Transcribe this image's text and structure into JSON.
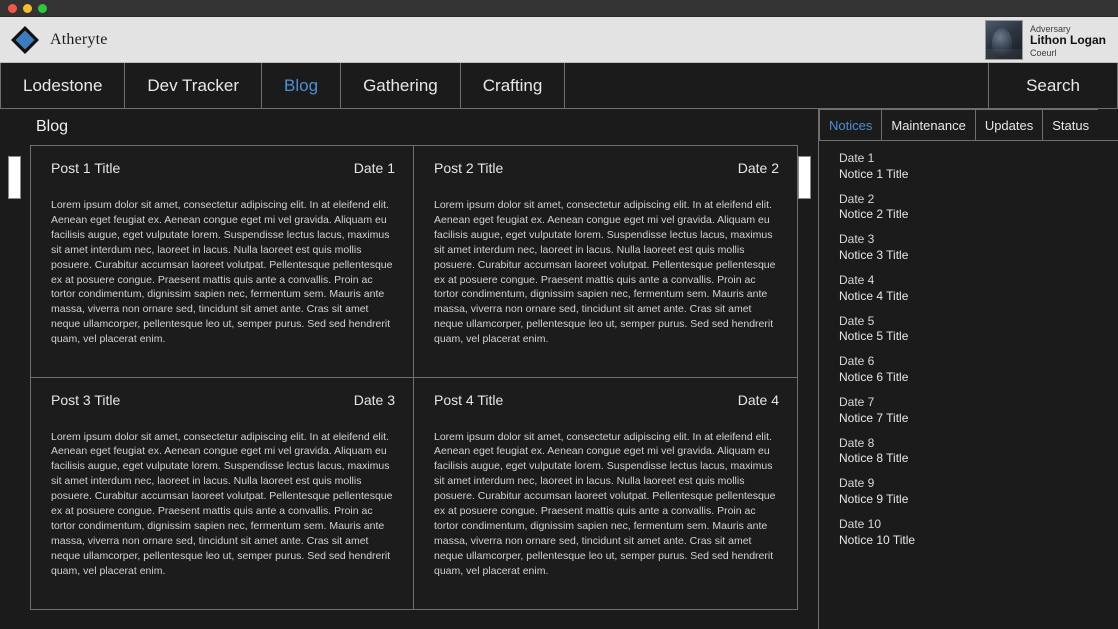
{
  "window": {
    "controls": [
      "close",
      "minimize",
      "maximize"
    ]
  },
  "brand": {
    "name": "Atheryte",
    "logo_icon": "diamond-logo-icon",
    "accent_color": "#4d8fd6"
  },
  "profile": {
    "title": "Adversary",
    "name": "Lithon Logan",
    "world": "Coeurl",
    "avatar_icon": "character-portrait-icon"
  },
  "nav": {
    "items": [
      {
        "label": "Lodestone",
        "active": false
      },
      {
        "label": "Dev Tracker",
        "active": false
      },
      {
        "label": "Blog",
        "active": true
      },
      {
        "label": "Gathering",
        "active": false
      },
      {
        "label": "Crafting",
        "active": false
      }
    ],
    "search_label": "Search"
  },
  "blog": {
    "heading": "Blog",
    "posts": [
      {
        "title": "Post 1 Title",
        "date": "Date 1",
        "body": "Lorem ipsum dolor sit amet, consectetur adipiscing elit. In at eleifend elit. Aenean eget feugiat ex. Aenean congue eget mi vel gravida. Aliquam eu facilisis augue, eget vulputate lorem. Suspendisse lectus lacus, maximus sit amet interdum nec, laoreet in lacus. Nulla laoreet est quis mollis posuere. Curabitur accumsan laoreet volutpat. Pellentesque pellentesque ex at posuere congue. Praesent mattis quis ante a convallis. Proin ac tortor condimentum, dignissim sapien nec, fermentum sem. Mauris ante massa, viverra non ornare sed, tincidunt sit amet ante. Cras sit amet neque ullamcorper, pellentesque leo ut, semper purus. Sed sed hendrerit quam, vel placerat enim."
      },
      {
        "title": "Post 2 Title",
        "date": "Date 2",
        "body": "Lorem ipsum dolor sit amet, consectetur adipiscing elit. In at eleifend elit. Aenean eget feugiat ex. Aenean congue eget mi vel gravida. Aliquam eu facilisis augue, eget vulputate lorem. Suspendisse lectus lacus, maximus sit amet interdum nec, laoreet in lacus. Nulla laoreet est quis mollis posuere. Curabitur accumsan laoreet volutpat. Pellentesque pellentesque ex at posuere congue. Praesent mattis quis ante a convallis. Proin ac tortor condimentum, dignissim sapien nec, fermentum sem. Mauris ante massa, viverra non ornare sed, tincidunt sit amet ante. Cras sit amet neque ullamcorper, pellentesque leo ut, semper purus. Sed sed hendrerit quam, vel placerat enim."
      },
      {
        "title": "Post 3 Title",
        "date": "Date 3",
        "body": "Lorem ipsum dolor sit amet, consectetur adipiscing elit. In at eleifend elit. Aenean eget feugiat ex. Aenean congue eget mi vel gravida. Aliquam eu facilisis augue, eget vulputate lorem. Suspendisse lectus lacus, maximus sit amet interdum nec, laoreet in lacus. Nulla laoreet est quis mollis posuere. Curabitur accumsan laoreet volutpat. Pellentesque pellentesque ex at posuere congue. Praesent mattis quis ante a convallis. Proin ac tortor condimentum, dignissim sapien nec, fermentum sem. Mauris ante massa, viverra non ornare sed, tincidunt sit amet ante. Cras sit amet neque ullamcorper, pellentesque leo ut, semper purus. Sed sed hendrerit quam, vel placerat enim."
      },
      {
        "title": "Post 4 Title",
        "date": "Date 4",
        "body": "Lorem ipsum dolor sit amet, consectetur adipiscing elit. In at eleifend elit. Aenean eget feugiat ex. Aenean congue eget mi vel gravida. Aliquam eu facilisis augue, eget vulputate lorem. Suspendisse lectus lacus, maximus sit amet interdum nec, laoreet in lacus. Nulla laoreet est quis mollis posuere. Curabitur accumsan laoreet volutpat. Pellentesque pellentesque ex at posuere congue. Praesent mattis quis ante a convallis. Proin ac tortor condimentum, dignissim sapien nec, fermentum sem. Mauris ante massa, viverra non ornare sed, tincidunt sit amet ante. Cras sit amet neque ullamcorper, pellentesque leo ut, semper purus. Sed sed hendrerit quam, vel placerat enim."
      }
    ]
  },
  "sidebar": {
    "tabs": [
      {
        "label": "Notices",
        "active": true
      },
      {
        "label": "Maintenance",
        "active": false
      },
      {
        "label": "Updates",
        "active": false
      },
      {
        "label": "Status",
        "active": false
      }
    ],
    "notices": [
      {
        "date": "Date 1",
        "title": "Notice 1 Title"
      },
      {
        "date": "Date 2",
        "title": "Notice 2 Title"
      },
      {
        "date": "Date 3",
        "title": "Notice 3 Title"
      },
      {
        "date": "Date 4",
        "title": "Notice 4 Title"
      },
      {
        "date": "Date 5",
        "title": "Notice 5 Title"
      },
      {
        "date": "Date 6",
        "title": "Notice 6 Title"
      },
      {
        "date": "Date 7",
        "title": "Notice 7 Title"
      },
      {
        "date": "Date 8",
        "title": "Notice 8 Title"
      },
      {
        "date": "Date 9",
        "title": "Notice 9 Title"
      },
      {
        "date": "Date 10",
        "title": "Notice 10 Title"
      }
    ]
  }
}
